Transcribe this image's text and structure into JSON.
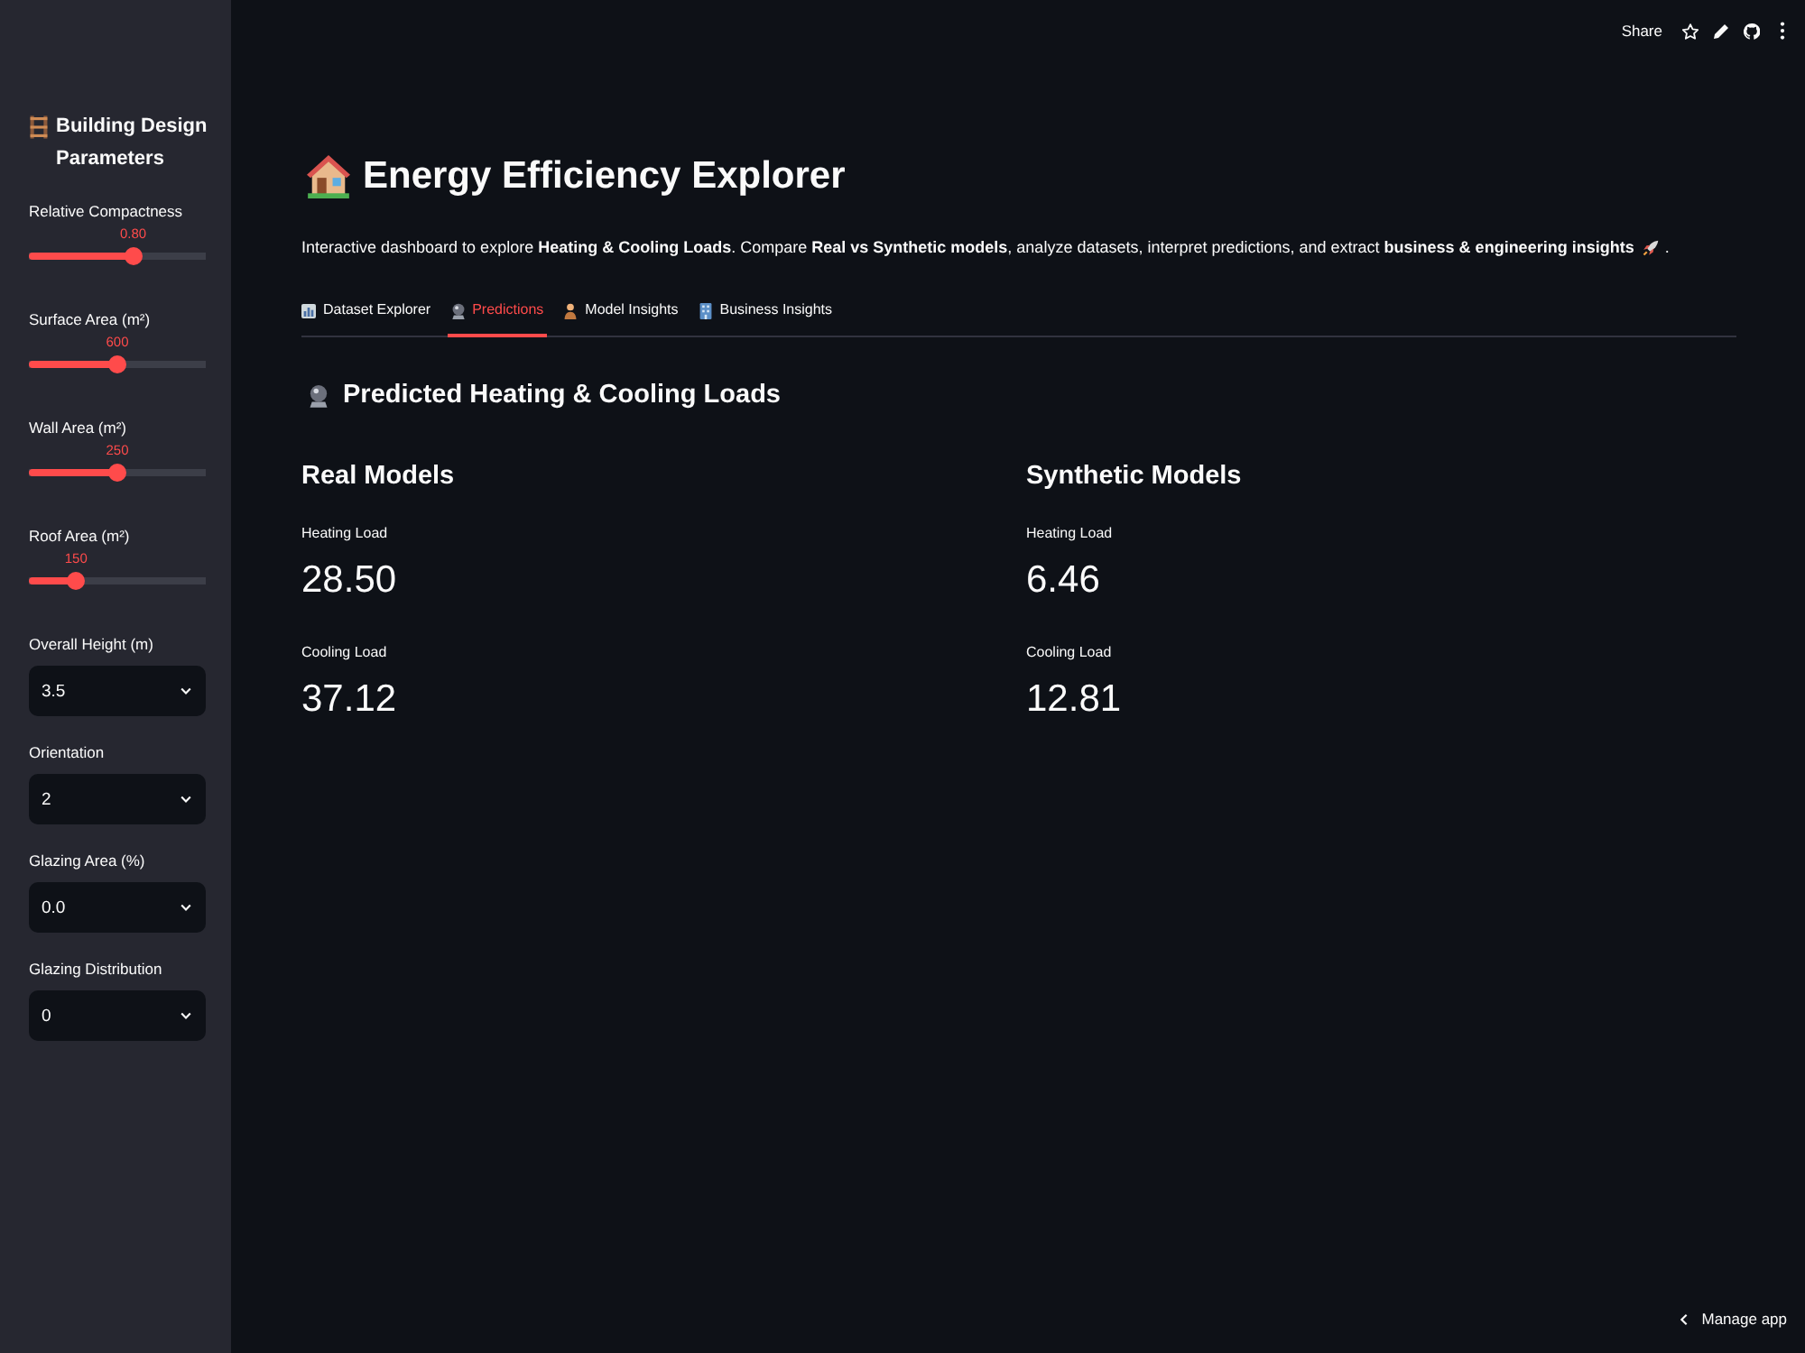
{
  "header": {
    "share": "Share"
  },
  "sidebar": {
    "title": "Building Design Parameters",
    "controls": [
      {
        "kind": "slider",
        "label": "Relative Compactness",
        "reading": "0.80",
        "level": 0.6
      },
      {
        "kind": "slider",
        "label": "Surface Area (m²)",
        "reading": "600",
        "level": 0.5
      },
      {
        "kind": "slider",
        "label": "Wall Area (m²)",
        "reading": "250",
        "level": 0.5
      },
      {
        "kind": "slider",
        "label": "Roof Area (m²)",
        "reading": "150",
        "level": 0.24
      },
      {
        "kind": "select",
        "label": "Overall Height (m)",
        "value": "3.5"
      },
      {
        "kind": "select",
        "label": "Orientation",
        "value": "2"
      },
      {
        "kind": "select",
        "label": "Glazing Area (%)",
        "value": "0.0"
      },
      {
        "kind": "select",
        "label": "Glazing Distribution",
        "value": "0"
      }
    ]
  },
  "main": {
    "title": "Energy Efficiency Explorer",
    "description": "Interactive dashboard to explore **Heating & Cooling Loads**. Compare **Real vs Synthetic models**, analyze datasets, interpret predictions, and extract **business & engineering insights**",
    "description_end": ".",
    "tabs": [
      {
        "label": "Dataset Explorer",
        "selected": false
      },
      {
        "label": "Predictions",
        "selected": true
      },
      {
        "label": "Model Insights",
        "selected": false
      },
      {
        "label": "Business Insights",
        "selected": false
      }
    ],
    "section_title": "Predicted Heating & Cooling Loads",
    "columns": [
      {
        "title": "Real Models",
        "metrics": [
          {
            "label": "Heating Load",
            "value": "28.50"
          },
          {
            "label": "Cooling Load",
            "value": "37.12"
          }
        ]
      },
      {
        "title": "Synthetic Models",
        "metrics": [
          {
            "label": "Heating Load",
            "value": "6.46"
          },
          {
            "label": "Cooling Load",
            "value": "12.81"
          }
        ]
      }
    ]
  },
  "footer": {
    "manage_app": "Manage app"
  }
}
